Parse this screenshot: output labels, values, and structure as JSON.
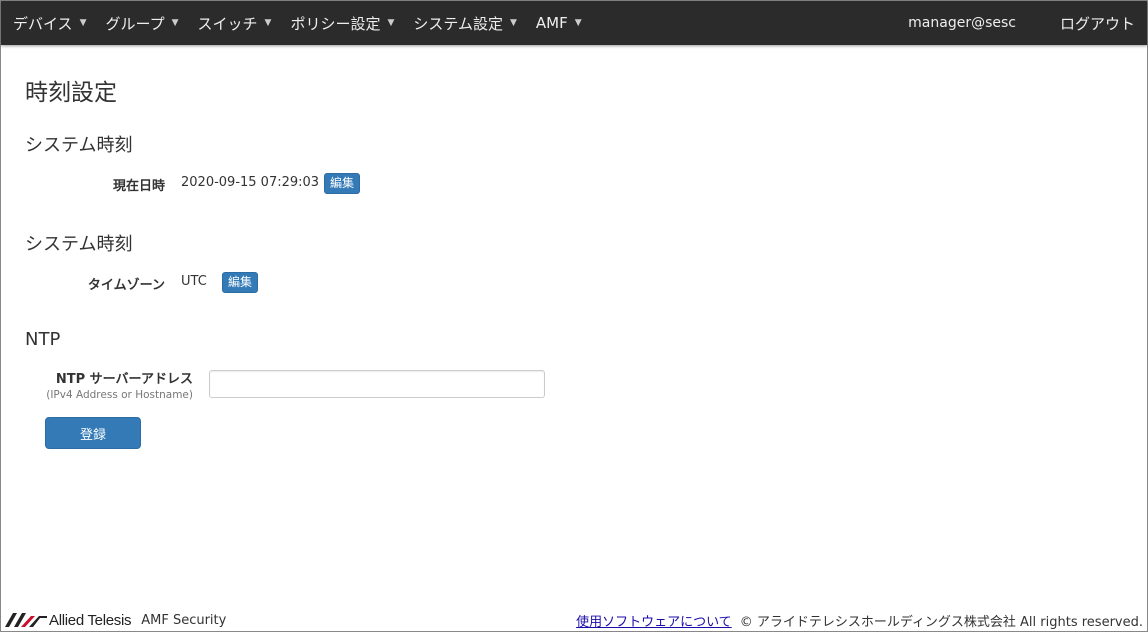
{
  "nav": {
    "items": [
      {
        "label": "デバイス"
      },
      {
        "label": "グループ"
      },
      {
        "label": "スイッチ"
      },
      {
        "label": "ポリシー設定"
      },
      {
        "label": "システム設定"
      },
      {
        "label": "AMF"
      }
    ],
    "user": "manager@sesc",
    "logout": "ログアウト"
  },
  "page": {
    "title": "時刻設定"
  },
  "system_time": {
    "title": "システム時刻",
    "label": "現在日時",
    "value": "2020-09-15 07:29:03",
    "edit": "編集"
  },
  "timezone": {
    "title": "システム時刻",
    "label": "タイムゾーン",
    "value": "UTC",
    "edit": "編集"
  },
  "ntp": {
    "title": "NTP",
    "label": "NTP サーバーアドレス",
    "sublabel": "(IPv4 Address or Hostname)",
    "value": "",
    "placeholder": "",
    "submit": "登録"
  },
  "footer": {
    "logo_text": "Allied Telesis",
    "product": "AMF Security",
    "link": "使用ソフトウェアについて",
    "copyright": "© アライドテレシスホールディングス株式会社 All rights reserved."
  },
  "colors": {
    "navbar": "#2b2b2b",
    "primary": "#337ab7",
    "link": "#1a0dab"
  }
}
